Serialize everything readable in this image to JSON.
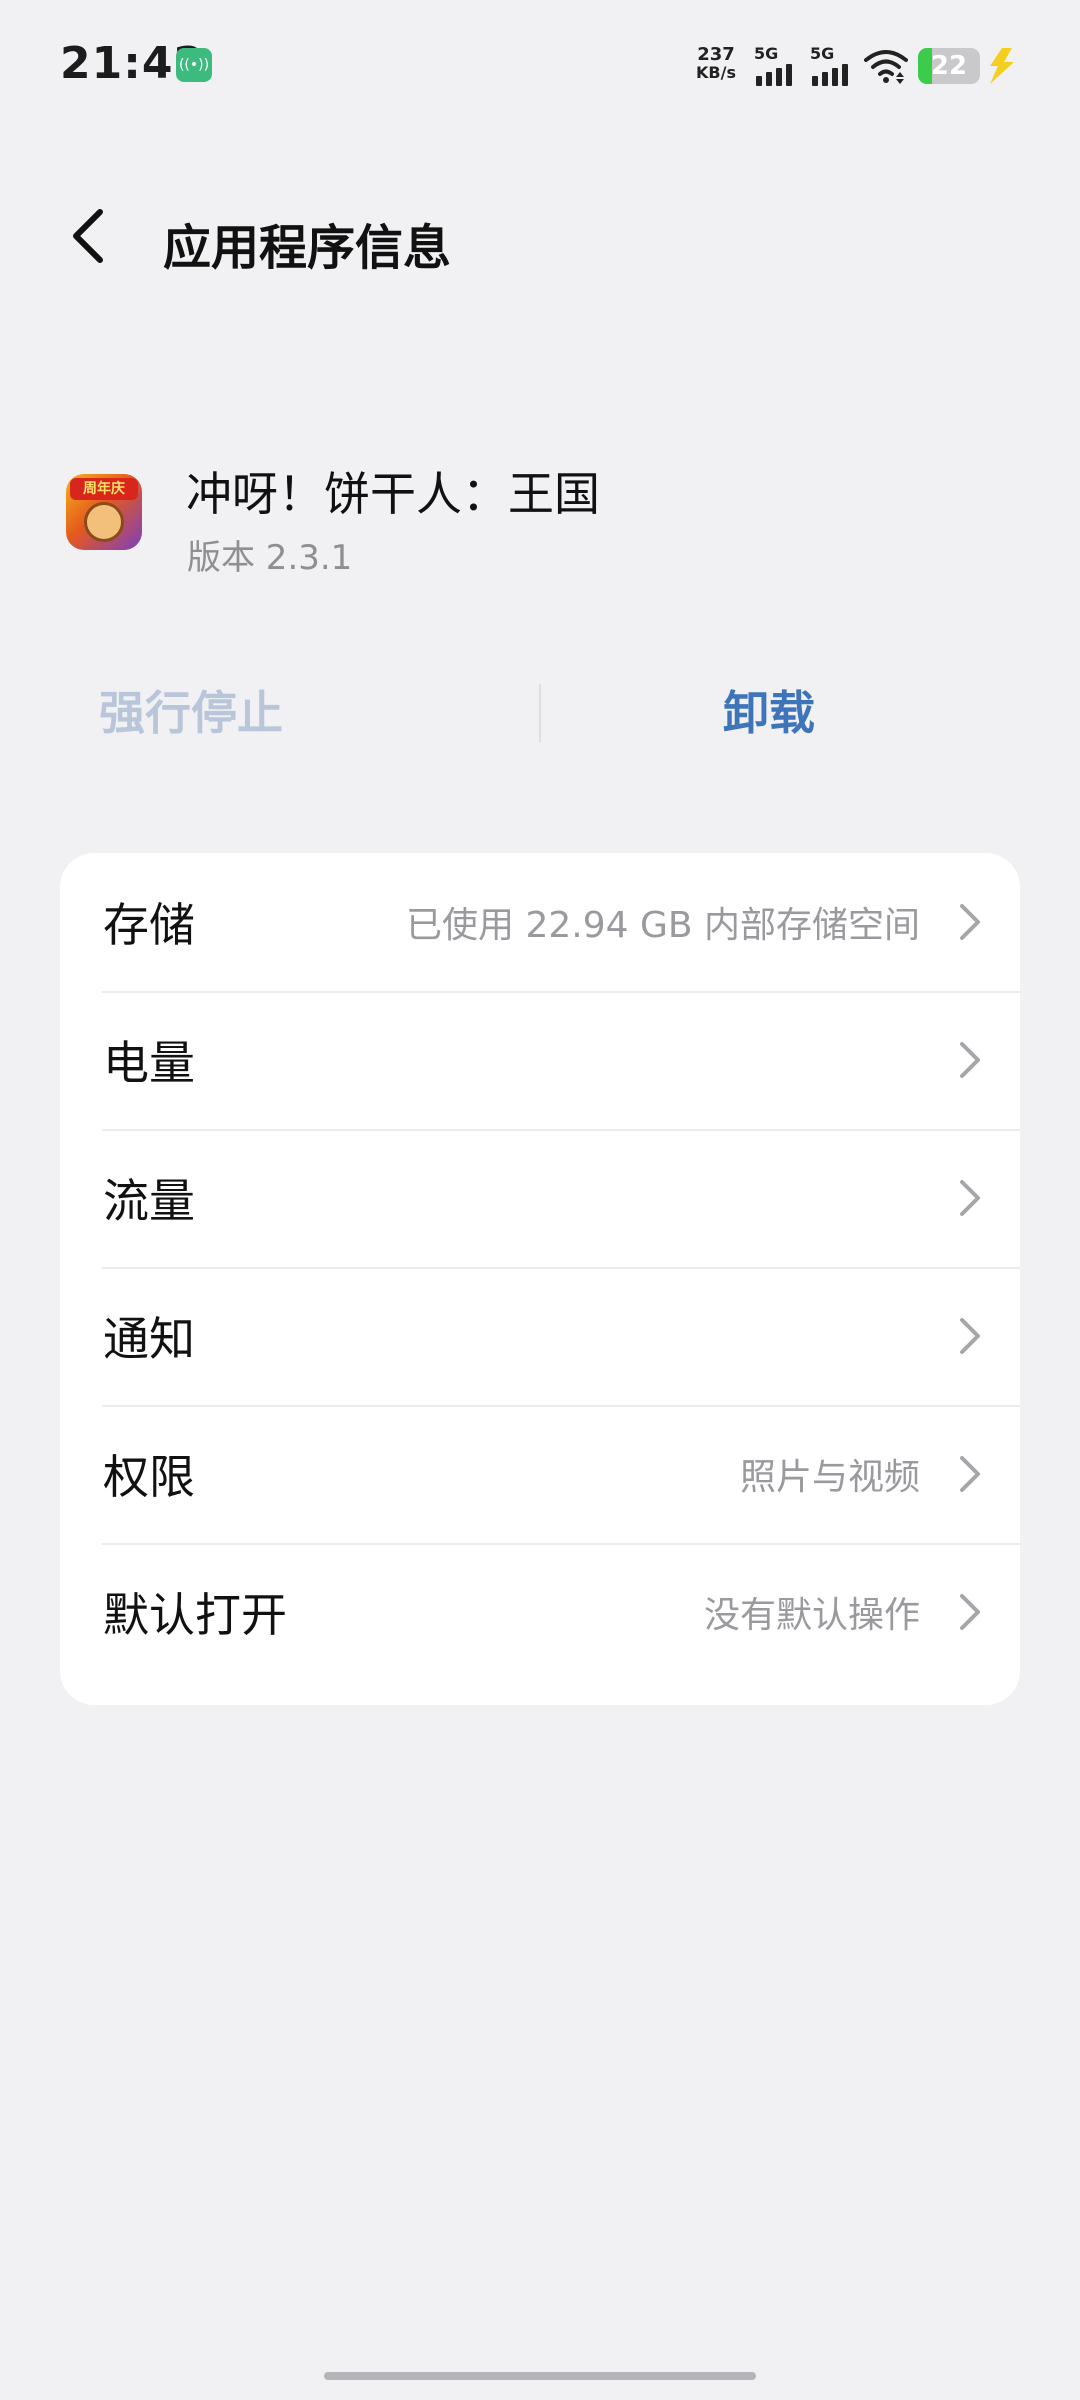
{
  "status_bar": {
    "time": "21:42",
    "net_speed_value": "237",
    "net_speed_unit": "KB/s",
    "signal_1_label": "5G",
    "signal_2_label": "5G",
    "battery_level": "22",
    "hotspot_icon": "hotspot-icon"
  },
  "header": {
    "title": "应用程序信息"
  },
  "app": {
    "name": "冲呀！饼干人：王国",
    "version": "版本 2.3.1",
    "icon_badge": "周年庆"
  },
  "actions": {
    "force_stop": "强行停止",
    "uninstall": "卸载"
  },
  "settings": [
    {
      "label": "存储",
      "value": "已使用 22.94 GB 内部存储空间"
    },
    {
      "label": "电量",
      "value": ""
    },
    {
      "label": "流量",
      "value": ""
    },
    {
      "label": "通知",
      "value": ""
    },
    {
      "label": "权限",
      "value": "照片与视频"
    },
    {
      "label": "默认打开",
      "value": "没有默认操作"
    }
  ],
  "colors": {
    "background": "#f1f1f3",
    "accent": "#3d74ba",
    "disabled_action": "#b9c6da",
    "battery_fill": "#3ccc4b",
    "hotspot": "#3dbb7f"
  }
}
